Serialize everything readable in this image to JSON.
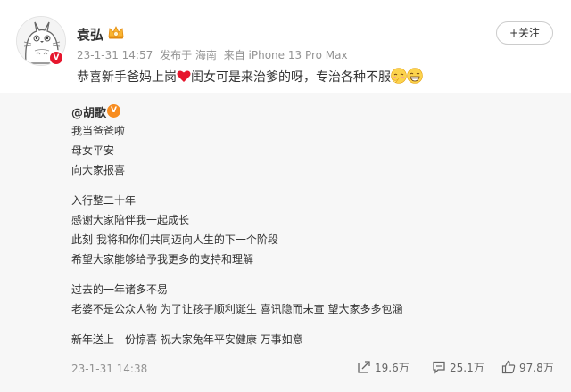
{
  "post": {
    "author": "袁弘",
    "time": "23-1-31 14:57",
    "location": "发布于 海南",
    "source": "来自 iPhone 13 Pro Max",
    "follow_label": "+关注",
    "text_before_heart": "恭喜新手爸妈上岗",
    "text_after_heart": "闺女可是来治爹的呀，专治各种不服"
  },
  "repost": {
    "author": "@胡歌",
    "lines": [
      "我当爸爸啦",
      "母女平安",
      "向大家报喜",
      "入行整二十年",
      "感谢大家陪伴我一起成长",
      "此刻 我将和你们共同迈向人生的下一个阶段",
      "希望大家能够给予我更多的支持和理解",
      "过去的一年诸多不易",
      "老婆不是公众人物 为了让孩子顺利诞生 喜讯隐而未宣 望大家多多包涵",
      "新年送上一份惊喜 祝大家兔年平安健康 万事如意"
    ],
    "time": "23-1-31 14:38",
    "reposts": "19.6万",
    "comments": "25.1万",
    "likes": "97.8万"
  },
  "colors": {
    "accent_red": "#e6162d",
    "meta_gray": "#939393",
    "repost_bg": "#f7f7f7"
  },
  "icons": [
    "avatar-totoro",
    "vip-crown-badge",
    "verified-badge",
    "heart-emoji",
    "shy-emoji",
    "grin-emoji",
    "repost-icon",
    "comment-icon",
    "like-icon"
  ]
}
